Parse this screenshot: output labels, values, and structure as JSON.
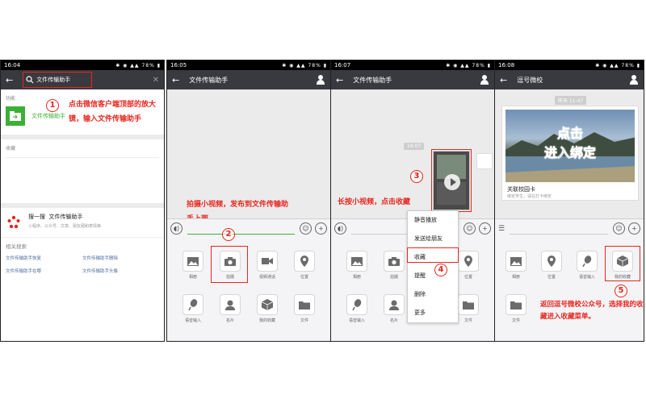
{
  "panel1": {
    "time": "16:04",
    "battery": "78%",
    "search_text": "文件传输助手",
    "section_function": "功能",
    "function_item": "文件传输助手",
    "section_favorites": "收藏",
    "souyisou_label": "搜一搜",
    "souyisou_query": "文件传输助手",
    "souyisou_sub": "小程序、公众号、文章、朋友圈和表情等",
    "related_title": "相关搜索",
    "related": [
      "文件传输助手恢复",
      "文件传输助手删除",
      "文件传输助手在哪",
      "文件传输助手头像"
    ],
    "annotation_num": "1",
    "annotation": "点击微信客户端顶部的放大镜，输入文件传输助手"
  },
  "panel2": {
    "time": "16:05",
    "battery": "78%",
    "title": "文件传输助手",
    "annotation_num": "2",
    "annotation": "拍摄小视频，发布到文件传输助手上面",
    "grid": [
      "相册",
      "拍摄",
      "视频通话",
      "位置",
      "语音输入",
      "名片",
      "我的收藏",
      "文件"
    ]
  },
  "panel3": {
    "time": "16:07",
    "battery": "78%",
    "title": "文件传输助手",
    "timestamp": "16:07",
    "annotation_num_3": "3",
    "annotation_num_4": "4",
    "annotation": "长按小视频，点击收藏",
    "menu": [
      "静音播放",
      "发送给朋友",
      "收藏",
      "提醒",
      "删除",
      "更多"
    ],
    "grid": [
      "相册",
      "拍摄",
      "视频通话",
      "位置",
      "语音输入",
      "名片",
      "我的收藏",
      "文件"
    ]
  },
  "panel4": {
    "time": "16:08",
    "battery": "78%",
    "title": "逗号微校",
    "timestamp": "昨天 11:47",
    "banner_line1": "点击",
    "banner_line2": "进入绑定",
    "card_title": "关联校园卡",
    "card_sub": "绑定学生，请在打卡绑定",
    "annotation_num": "5",
    "annotation": "返回逗号微校公众号，选择我的收藏进入收藏菜单。",
    "grid": [
      "相册",
      "位置",
      "语音输入",
      "我的收藏",
      "文件"
    ]
  },
  "colors": {
    "accent_red": "#e8261e",
    "wechat_green": "#3cb034",
    "topbar": "#393a3f"
  }
}
